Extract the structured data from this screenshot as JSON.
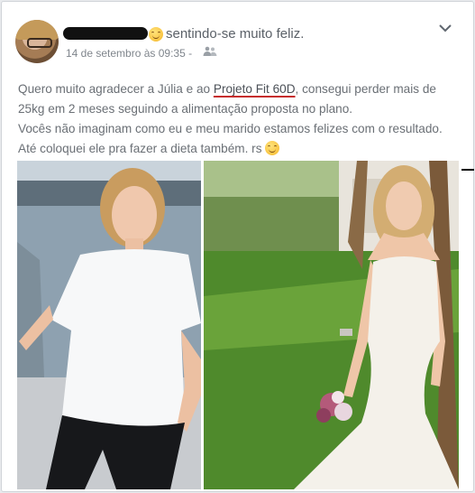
{
  "post": {
    "feeling_text": "sentindo-se muito feliz.",
    "timestamp": "14 de setembro às 09:35 -",
    "audience_icon": "friends-icon",
    "menu_icon": "chevron-down-icon",
    "lines": [
      {
        "before": "Quero muito agradecer a Júlia e ao ",
        "link": "Projeto Fit 60D",
        "after": ", consegui perder mais de"
      },
      {
        "text": "25kg em 2 meses seguindo a alimentação proposta no plano."
      },
      {
        "text": "Vocês não imaginam como eu e meu marido estamos felizes com o resultado."
      },
      {
        "text": "Até coloquei ele pra fazer a dieta também. rs"
      }
    ]
  },
  "colors": {
    "link_underline": "#c62d2d",
    "text": "#6a6f75",
    "meta": "#7f858c"
  },
  "photos": {
    "before_icon": "photo-before",
    "after_icon": "photo-after"
  }
}
